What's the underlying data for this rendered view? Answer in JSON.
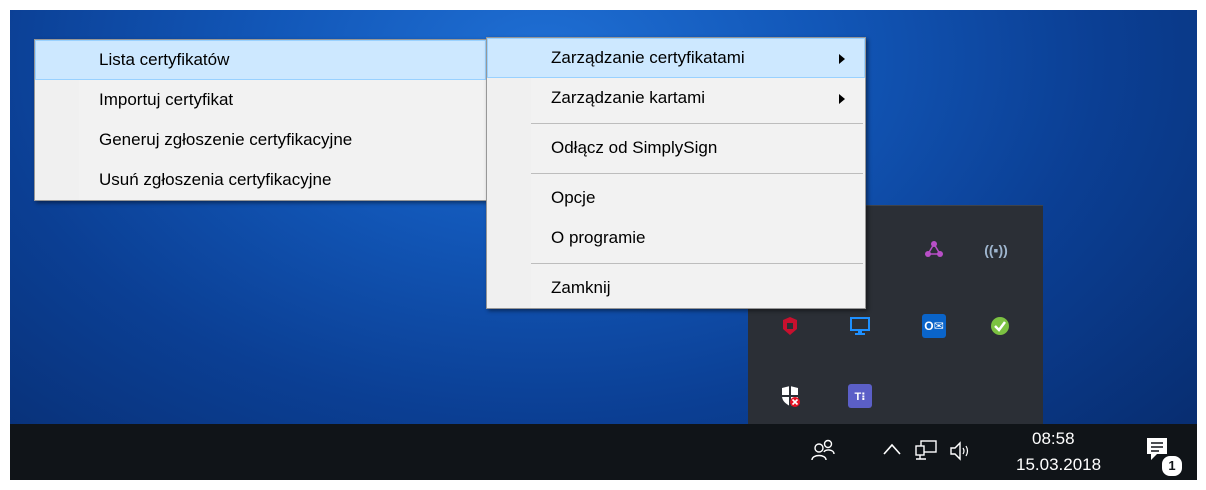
{
  "submenu": {
    "items": [
      {
        "label": "Lista certyfikatów",
        "highlighted": true
      },
      {
        "label": "Importuj certyfikat"
      },
      {
        "label": "Generuj zgłoszenie certyfikacyjne"
      },
      {
        "label": "Usuń zgłoszenia certyfikacyjne"
      }
    ]
  },
  "main_menu": {
    "items": [
      {
        "label": "Zarządzanie certyfikatami",
        "has_submenu": true,
        "highlighted": true
      },
      {
        "label": "Zarządzanie kartami",
        "has_submenu": true
      },
      {
        "label": "Odłącz od SimplySign"
      },
      {
        "label": "Opcje"
      },
      {
        "label": "O programie"
      },
      {
        "label": "Zamknij"
      }
    ]
  },
  "tray_overflow": {
    "icons": [
      "antivirus-red-icon",
      "remote-desktop-icon",
      "outlook-icon",
      "green-check-app-icon",
      "security-shield-error-icon",
      "teams-icon",
      "network-nodes-icon",
      "wireless-card-icon"
    ]
  },
  "taskbar": {
    "clock_time": "08:58",
    "clock_date": "15.03.2018",
    "notification_count": "1"
  }
}
